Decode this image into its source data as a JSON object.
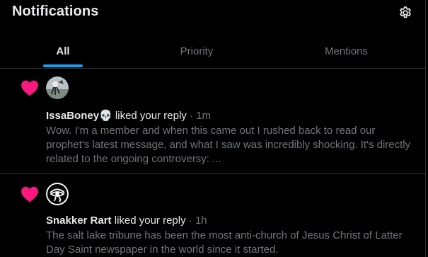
{
  "header": {
    "title": "Notifications",
    "settings_icon": "gear-icon"
  },
  "tabs": [
    {
      "label": "All",
      "active": true
    },
    {
      "label": "Priority",
      "active": false
    },
    {
      "label": "Mentions",
      "active": false
    }
  ],
  "colors": {
    "accent": "#1d9bf0",
    "heart": "#f91880",
    "divider": "#2f3336",
    "muted": "#71767b"
  },
  "notifications": [
    {
      "icon": "heart-icon",
      "user": "IssaBoney",
      "emoji": "💀",
      "action": " liked your reply",
      "time": " · 1m",
      "text": "Wow. I'm a member and when this came out I rushed back to read our prophet's latest message, and what I saw was incredibly shocking. It's directly related to the ongoing controversy: ..."
    },
    {
      "icon": "heart-icon",
      "user": "Snakker Rart",
      "emoji": "",
      "action": " liked your reply",
      "time": " · 1h",
      "text": "The salt lake tribune has been the most anti-church of Jesus Christ of Latter Day Saint newspaper in the world since it started."
    }
  ]
}
